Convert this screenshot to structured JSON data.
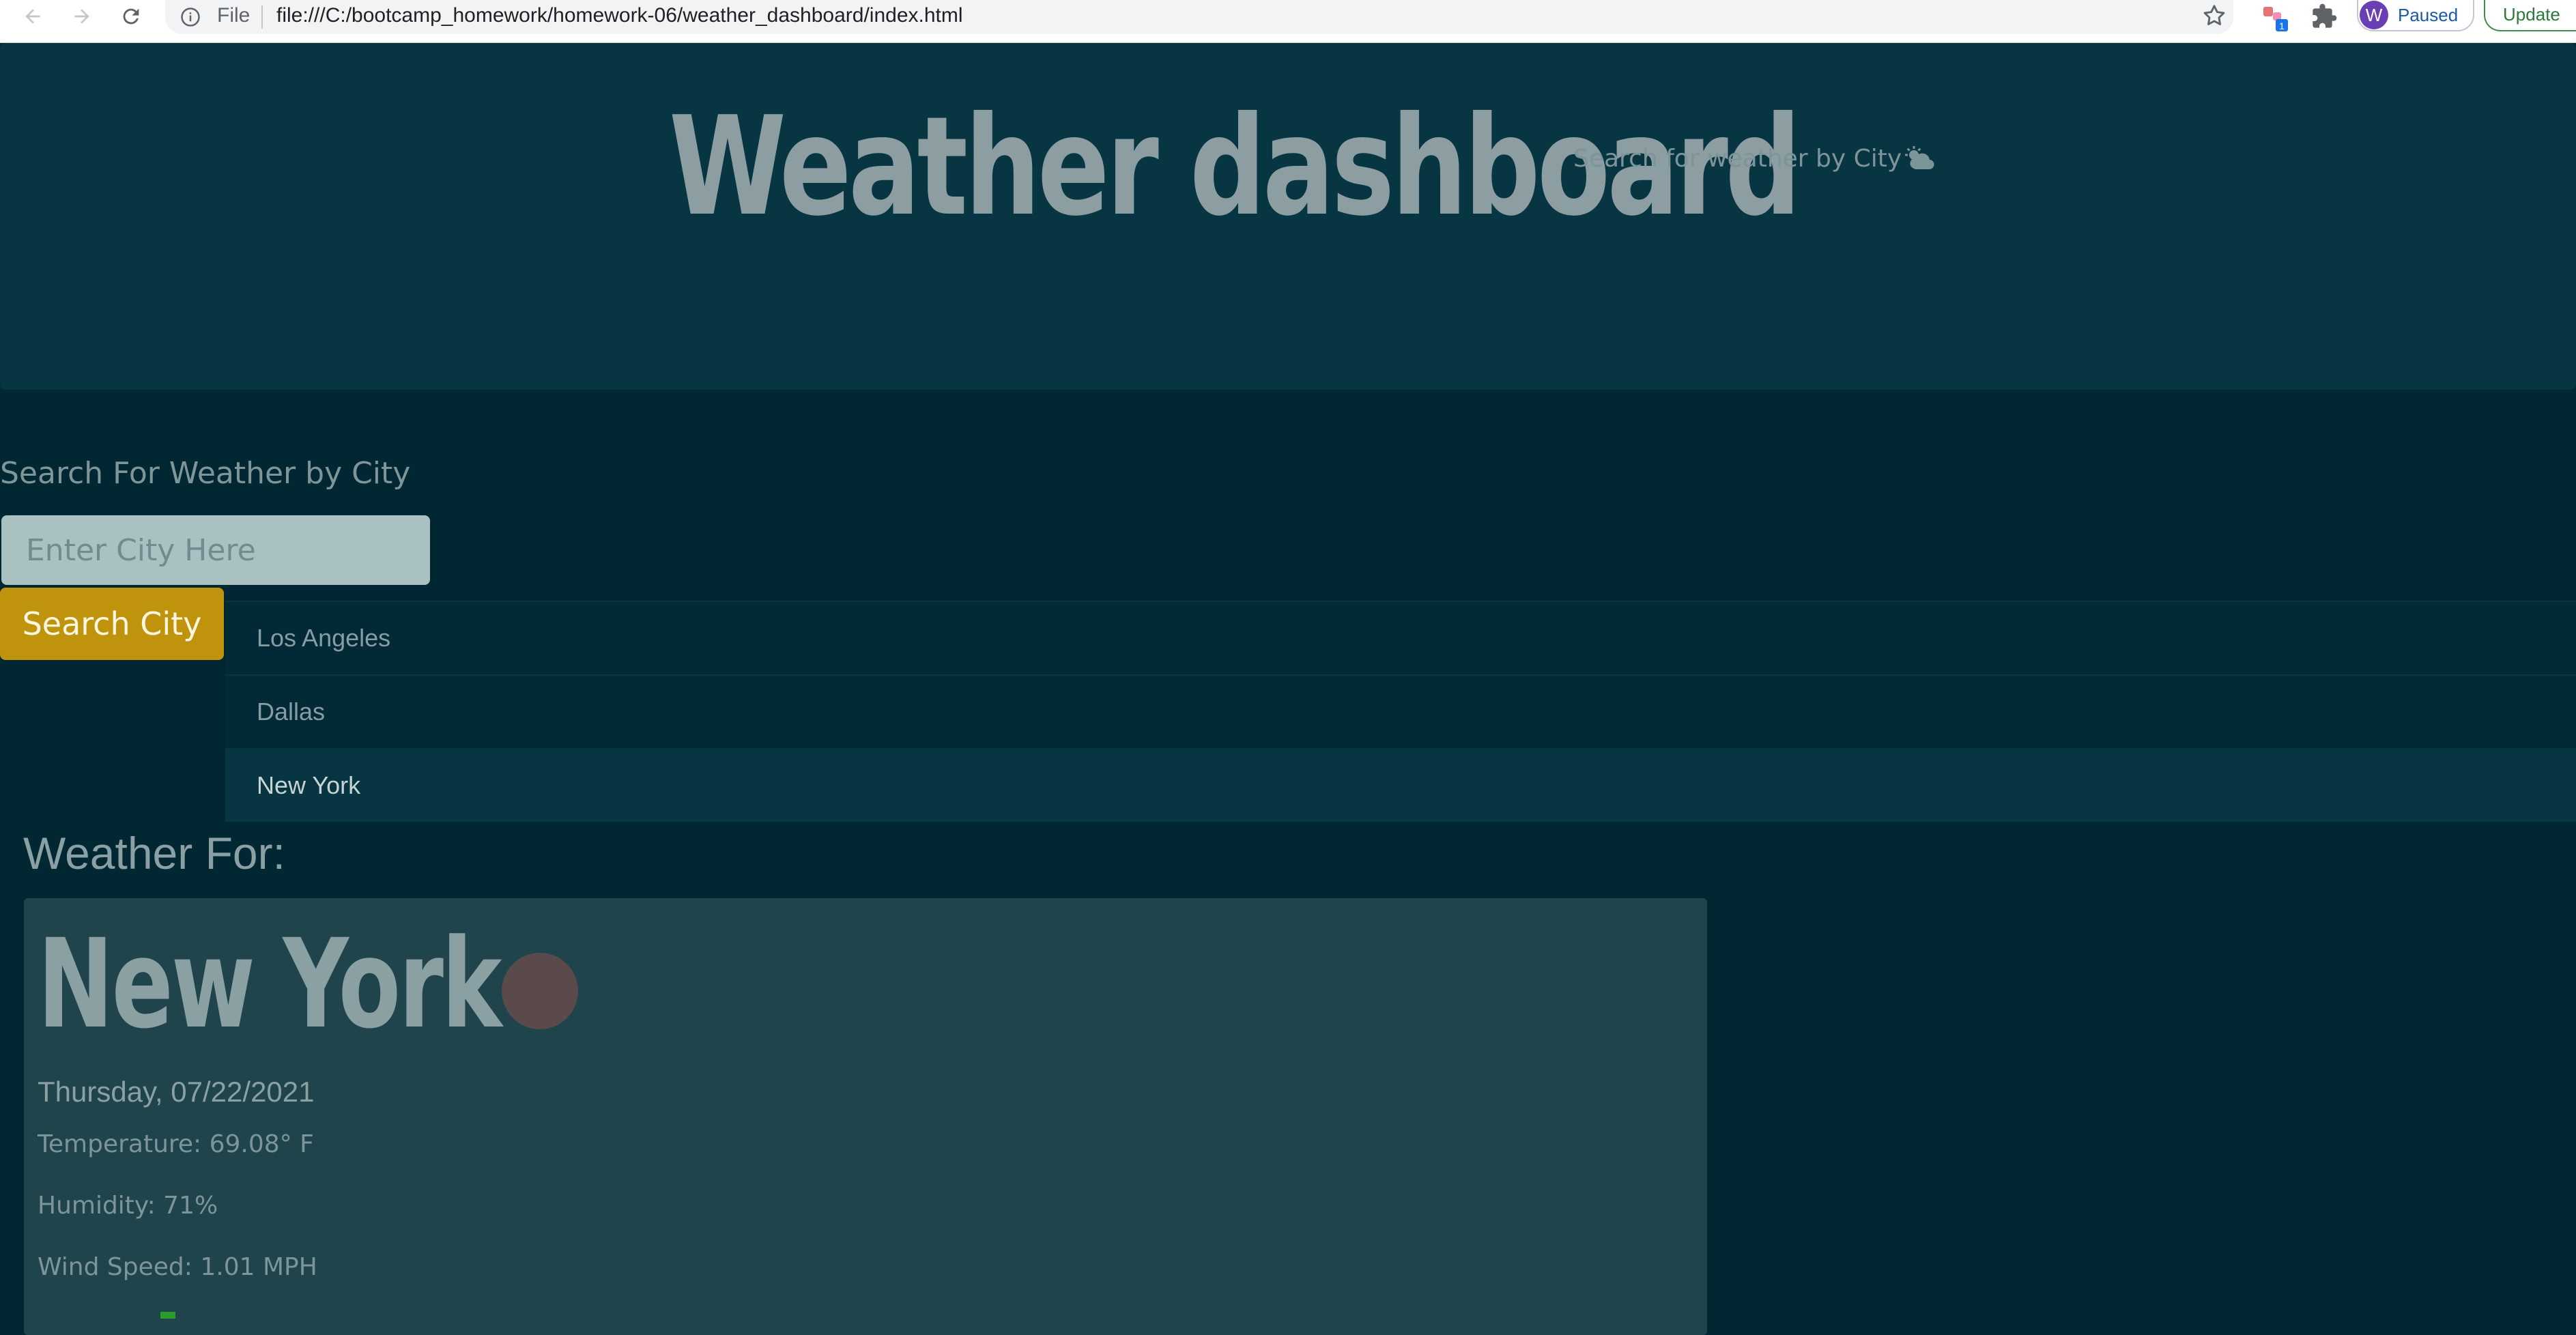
{
  "browser": {
    "file_label": "File",
    "url": "file:///C:/bootcamp_homework/homework-06/weather_dashboard/index.html",
    "profile_initial": "W",
    "profile_status": "Paused",
    "update_label": "Update",
    "extension_badge": "1"
  },
  "header": {
    "title": "Weather dashboard",
    "lead": "Search for weather by City"
  },
  "search": {
    "heading": "Search For Weather by City",
    "placeholder": "Enter City Here",
    "button_label": "Search City"
  },
  "recent_cities": [
    {
      "name": "Los Angeles"
    },
    {
      "name": "Dallas"
    },
    {
      "name": "New York"
    }
  ],
  "current": {
    "heading": "Weather For:",
    "city": "New York",
    "date": "Thursday, 07/22/2021",
    "temperature": "Temperature: 69.08° F",
    "humidity": "Humidity: 71%",
    "wind": "Wind Speed: 1.01 MPH"
  }
}
